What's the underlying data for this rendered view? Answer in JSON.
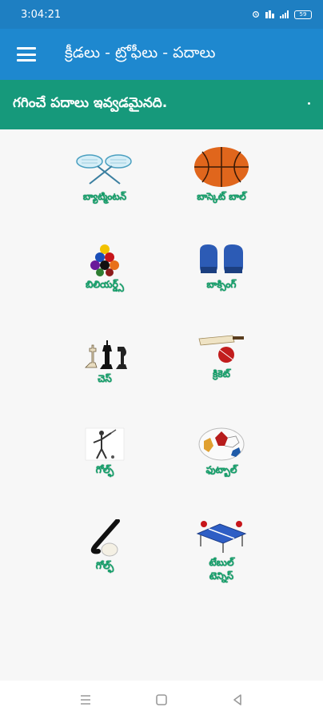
{
  "status_bar": {
    "time": "3:04:21",
    "battery": "59"
  },
  "app_bar": {
    "title": "క్రీడలు - ట్రోఫీలు - పదాలు",
    "menu_icon": "hamburger-menu-icon"
  },
  "marquee": {
    "text": "గగించే పదాలు ఇవ్వడమైనది."
  },
  "sports": [
    {
      "label": "బ్యాట్మింటన్",
      "icon": "badminton-icon"
    },
    {
      "label": "బాస్కెట్ బాల్",
      "icon": "basketball-icon"
    },
    {
      "label": "బిలియర్డ్స్",
      "icon": "billiards-icon"
    },
    {
      "label": "బాక్సింగ్",
      "icon": "boxing-gloves-icon"
    },
    {
      "label": "చెస్",
      "icon": "chess-icon"
    },
    {
      "label": "క్రికెట్",
      "icon": "cricket-icon"
    },
    {
      "label": "గోల్ఫ్",
      "icon": "golf-icon"
    },
    {
      "label": "ఫుట్బాల్",
      "icon": "football-icon"
    },
    {
      "label": "గోల్ఫ్",
      "icon": "hockey-icon"
    },
    {
      "label": "టేబుల్ టెన్నిస్",
      "icon": "table-tennis-icon"
    }
  ],
  "nav_bar": {
    "icons": [
      "recent-apps-icon",
      "home-icon",
      "back-icon"
    ]
  }
}
